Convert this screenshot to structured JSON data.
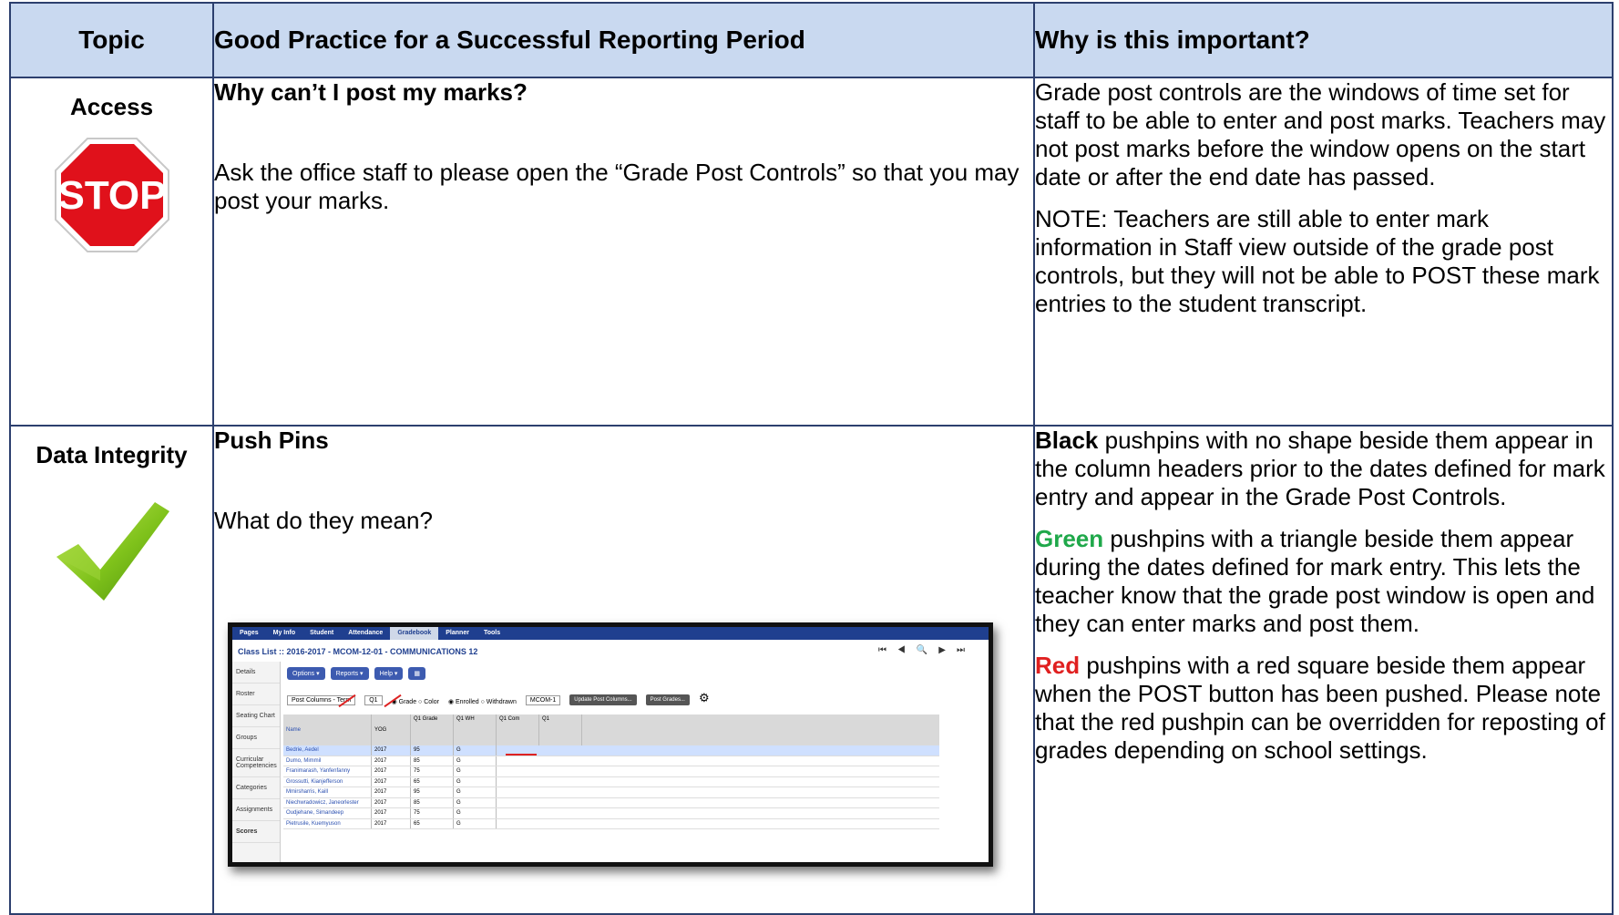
{
  "header": {
    "col1": "Topic",
    "col2": "Good Practice for a Successful Reporting Period",
    "col3": "Why is this important?"
  },
  "row1": {
    "topic": "Access",
    "stop_sign_text": "STOP",
    "question": "Why can’t I post my marks?",
    "answer": "Ask the office staff to please open the “Grade Post Controls” so that you may post your marks.",
    "why_p1": "Grade post controls are the windows of time set for staff to be able to enter and post marks. Teachers may not post marks before the window opens on the start date or after the end date has passed.",
    "why_p2": "NOTE: Teachers are still able to enter mark information in Staff view outside of the grade post controls, but they will not be able to POST these mark entries to the student transcript."
  },
  "row2": {
    "topic": "Data Integrity",
    "question": "Push Pins",
    "answer": "What do they mean?",
    "black_word": "Black",
    "black_text": " pushpins with no shape beside them appear in the column headers prior to the dates defined for mark entry and appear in the Grade Post Controls.",
    "green_word": "Green",
    "green_text": " pushpins with a triangle beside them appear during the dates defined for mark entry. This lets the teacher know that the grade post window is open and they can enter marks and post them.",
    "red_word": "Red",
    "red_text": " pushpins with a red square beside them appear when the POST button has been pushed. Please note that the red pushpin can be overridden for reposting of grades depending on school settings."
  },
  "colors": {
    "header_bg": "#c9d9f0",
    "border": "#2c3f6e",
    "green": "#1fa84a",
    "red": "#e02020"
  },
  "screenshot": {
    "nav": [
      "Pages",
      "My Info",
      "Student",
      "Attendance",
      "Gradebook",
      "Planner",
      "Tools"
    ],
    "title": "Class List :: 2016-2017 - MCOM-12-01 - COMMUNICATIONS 12",
    "side": [
      "Details",
      "Roster",
      "Seating Chart",
      "Groups",
      "Curricular Competencies",
      "Categories",
      "Assignments",
      "Scores"
    ],
    "buttons": [
      "Options ▾",
      "Reports ▾",
      "Help ▾"
    ],
    "grade_columns": "Post Columns - Term",
    "term": "Q1",
    "class_sel": "MCOM-1",
    "update_btn": "Update Post Columns...",
    "post_btn": "Post Grades...",
    "headers": [
      "Name",
      "YOG",
      "Q1 Grade",
      "Q1 WH",
      "Q1 Com",
      "Q1"
    ],
    "rows": [
      {
        "name": "Bedrie, Aedel",
        "yog": "2017",
        "grade": "95",
        "wh": "G"
      },
      {
        "name": "Dumo, Mimmil",
        "yog": "2017",
        "grade": "85",
        "wh": "G"
      },
      {
        "name": "Franimarash, Yanfenfanny",
        "yog": "2017",
        "grade": "75",
        "wh": "G"
      },
      {
        "name": "Grossutti, Kianjefferson",
        "yog": "2017",
        "grade": "65",
        "wh": "G"
      },
      {
        "name": "Mmirsharris, Kaill",
        "yog": "2017",
        "grade": "95",
        "wh": "G"
      },
      {
        "name": "Niechwradowicz, Janeorlester",
        "yog": "2017",
        "grade": "85",
        "wh": "G"
      },
      {
        "name": "Oudjehane, Simandeep",
        "yog": "2017",
        "grade": "75",
        "wh": "G"
      },
      {
        "name": "Pietrusile, Kuemyuson",
        "yog": "2017",
        "grade": "65",
        "wh": "G"
      }
    ]
  }
}
